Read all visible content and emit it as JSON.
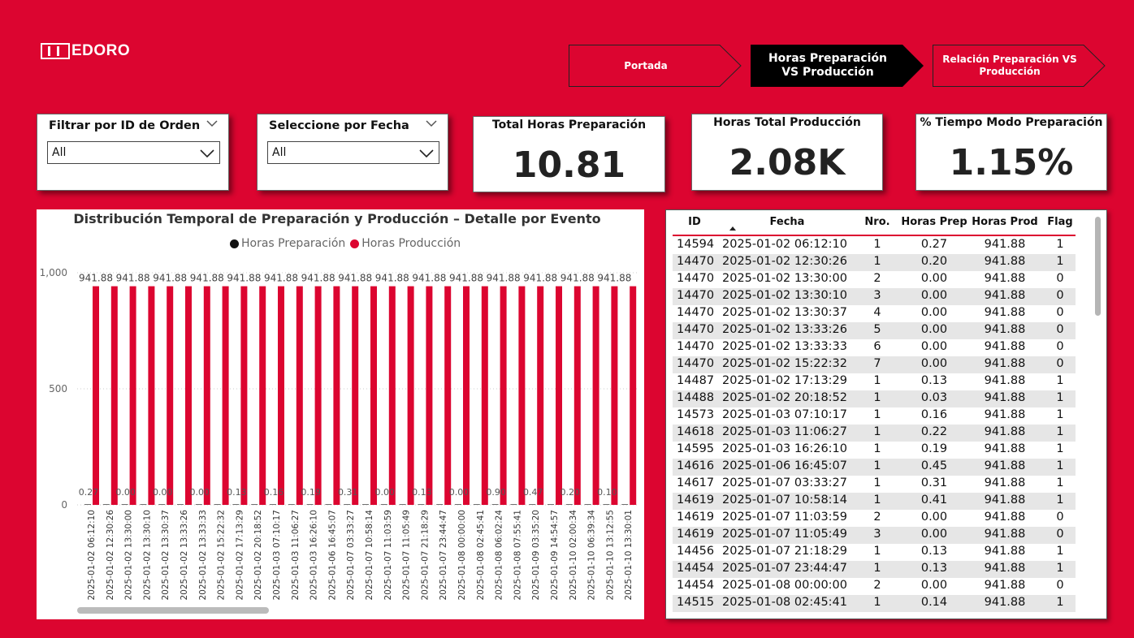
{
  "logo": {
    "text": "EDORO"
  },
  "nav": {
    "tabs": [
      {
        "label": "Portada",
        "active": false
      },
      {
        "label": "Horas Preparación VS Producción",
        "active": true
      },
      {
        "label": "Relación Preparación VS Producción",
        "active": false
      }
    ]
  },
  "filters": {
    "order": {
      "title": "Filtrar por ID de Orden",
      "value": "All"
    },
    "date": {
      "title": "Seleccione por Fecha",
      "value": "All"
    }
  },
  "kpis": {
    "prep": {
      "title": "Total Horas Preparación",
      "value": "10.81"
    },
    "prod": {
      "title": "Horas Total Producción",
      "value": "2.08K"
    },
    "pct": {
      "title": "% Tiempo Modo Preparación",
      "value": "1.15%"
    }
  },
  "chart_data": {
    "type": "bar",
    "title": "Distribución Temporal de Preparación y Producción – Detalle por Evento",
    "ylim": [
      0,
      1000
    ],
    "yticks": [
      "0",
      "500",
      "1,000"
    ],
    "grid": true,
    "legend_position": "top",
    "categories": [
      "2025-01-02 06:12:10",
      "2025-01-02 12:30:26",
      "2025-01-02 13:30:00",
      "2025-01-02 13:30:10",
      "2025-01-02 13:30:37",
      "2025-01-02 13:33:26",
      "2025-01-02 13:33:33",
      "2025-01-02 15:22:32",
      "2025-01-02 17:13:29",
      "2025-01-02 20:18:52",
      "2025-01-03 07:10:17",
      "2025-01-03 11:06:27",
      "2025-01-03 16:26:10",
      "2025-01-06 16:45:07",
      "2025-01-07 03:33:27",
      "2025-01-07 10:58:14",
      "2025-01-07 11:03:59",
      "2025-01-07 11:05:49",
      "2025-01-07 21:18:29",
      "2025-01-07 23:44:47",
      "2025-01-08 00:00:00",
      "2025-01-08 02:45:41",
      "2025-01-08 06:02:24",
      "2025-01-08 07:55:41",
      "2025-01-09 03:35:20",
      "2025-01-09 14:54:57",
      "2025-01-10 02:00:34",
      "2025-01-10 06:39:34",
      "2025-01-10 13:12:55",
      "2025-01-10 13:30:01"
    ],
    "series": [
      {
        "name": "Horas Preparación",
        "color": "#111111",
        "values": [
          0.27,
          0.2,
          0.0,
          0.0,
          0.0,
          0.0,
          0.0,
          0.0,
          0.13,
          0.03,
          0.16,
          0.22,
          0.19,
          0.45,
          0.31,
          0.41,
          0.0,
          0.0,
          0.13,
          0.13,
          0.0,
          0.14,
          0.9,
          0.0,
          0.47,
          0.0,
          0.2,
          0.0,
          0.1,
          0.0
        ],
        "value_labels": [
          "0.27",
          "",
          "0.00",
          "",
          "0.00",
          "",
          "0.00",
          "",
          "0.13",
          "",
          "0.16",
          "",
          "0.19",
          "",
          "0.31",
          "",
          "0.00",
          "",
          "0.13",
          "",
          "0.00",
          "",
          "0.90",
          "",
          "0.47",
          "",
          "0.20",
          "",
          "0.10",
          ""
        ]
      },
      {
        "name": "Horas Producción",
        "color": "#dc0530",
        "values": [
          941.88,
          941.88,
          941.88,
          941.88,
          941.88,
          941.88,
          941.88,
          941.88,
          941.88,
          941.88,
          941.88,
          941.88,
          941.88,
          941.88,
          941.88,
          941.88,
          941.88,
          941.88,
          941.88,
          941.88,
          941.88,
          941.88,
          941.88,
          941.88,
          941.88,
          941.88,
          941.88,
          941.88,
          941.88,
          941.88
        ],
        "value_labels": [
          "941.88",
          "",
          "941.88",
          "",
          "941.88",
          "",
          "941.88",
          "",
          "941.88",
          "",
          "941.88",
          "",
          "941.88",
          "",
          "941.88",
          "",
          "941.88",
          "",
          "941.88",
          "",
          "941.88",
          "",
          "941.88",
          "",
          "941.88",
          "",
          "941.88",
          "",
          "941.88",
          ""
        ]
      }
    ]
  },
  "table": {
    "headers": {
      "id": "ID",
      "fecha": "Fecha",
      "nro": "Nro.",
      "prep": "Horas Prep",
      "prod": "Horas Prod",
      "flag": "Flag"
    },
    "rows": [
      [
        "14594",
        "2025-01-02 06:12:10",
        "1",
        "0.27",
        "941.88",
        "1"
      ],
      [
        "14470",
        "2025-01-02 12:30:26",
        "1",
        "0.20",
        "941.88",
        "1"
      ],
      [
        "14470",
        "2025-01-02 13:30:00",
        "2",
        "0.00",
        "941.88",
        "0"
      ],
      [
        "14470",
        "2025-01-02 13:30:10",
        "3",
        "0.00",
        "941.88",
        "0"
      ],
      [
        "14470",
        "2025-01-02 13:30:37",
        "4",
        "0.00",
        "941.88",
        "0"
      ],
      [
        "14470",
        "2025-01-02 13:33:26",
        "5",
        "0.00",
        "941.88",
        "0"
      ],
      [
        "14470",
        "2025-01-02 13:33:33",
        "6",
        "0.00",
        "941.88",
        "0"
      ],
      [
        "14470",
        "2025-01-02 15:22:32",
        "7",
        "0.00",
        "941.88",
        "0"
      ],
      [
        "14487",
        "2025-01-02 17:13:29",
        "1",
        "0.13",
        "941.88",
        "1"
      ],
      [
        "14488",
        "2025-01-02 20:18:52",
        "1",
        "0.03",
        "941.88",
        "1"
      ],
      [
        "14573",
        "2025-01-03 07:10:17",
        "1",
        "0.16",
        "941.88",
        "1"
      ],
      [
        "14618",
        "2025-01-03 11:06:27",
        "1",
        "0.22",
        "941.88",
        "1"
      ],
      [
        "14595",
        "2025-01-03 16:26:10",
        "1",
        "0.19",
        "941.88",
        "1"
      ],
      [
        "14616",
        "2025-01-06 16:45:07",
        "1",
        "0.45",
        "941.88",
        "1"
      ],
      [
        "14617",
        "2025-01-07 03:33:27",
        "1",
        "0.31",
        "941.88",
        "1"
      ],
      [
        "14619",
        "2025-01-07 10:58:14",
        "1",
        "0.41",
        "941.88",
        "1"
      ],
      [
        "14619",
        "2025-01-07 11:03:59",
        "2",
        "0.00",
        "941.88",
        "0"
      ],
      [
        "14619",
        "2025-01-07 11:05:49",
        "3",
        "0.00",
        "941.88",
        "0"
      ],
      [
        "14456",
        "2025-01-07 21:18:29",
        "1",
        "0.13",
        "941.88",
        "1"
      ],
      [
        "14454",
        "2025-01-07 23:44:47",
        "1",
        "0.13",
        "941.88",
        "1"
      ],
      [
        "14454",
        "2025-01-08 00:00:00",
        "2",
        "0.00",
        "941.88",
        "0"
      ],
      [
        "14515",
        "2025-01-08 02:45:41",
        "1",
        "0.14",
        "941.88",
        "1"
      ]
    ]
  },
  "colors": {
    "brand": "#dc0530",
    "prep": "#111111",
    "prod": "#dc0530"
  }
}
